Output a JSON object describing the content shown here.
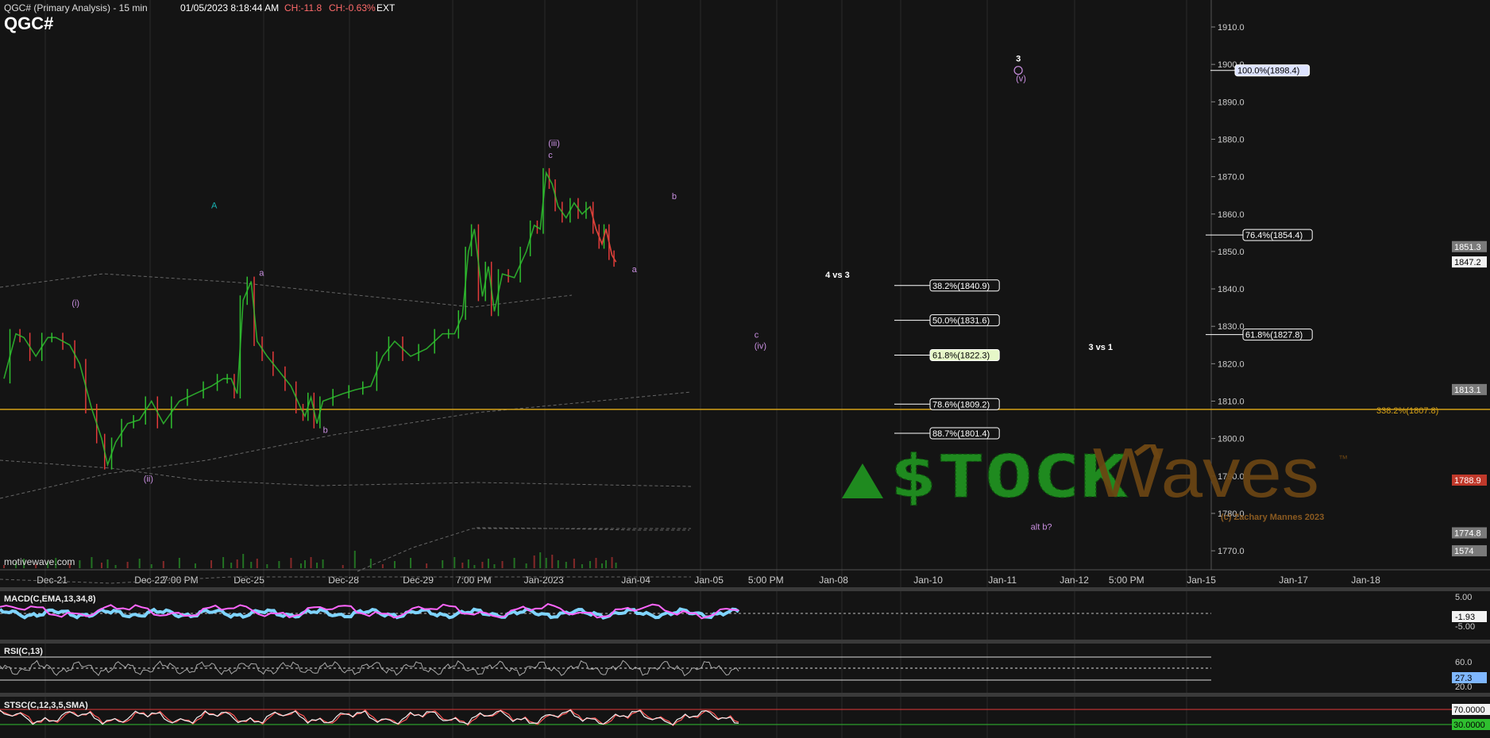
{
  "header": {
    "title": "QGC# (Primary Analysis) - 15 min",
    "datetime": "01/05/2023 8:18:44 AM",
    "change": "CH:-11.8",
    "change_pct": "CH:-0.63%",
    "session": "EXT",
    "symbol": "QGC#"
  },
  "watermark": {
    "site": "motivewave.com",
    "logo_left": "$TOCK",
    "logo_right": "Waves",
    "trademark": "™",
    "copyright": "(c) Zachary Mannes 2023"
  },
  "colors": {
    "background": "#141414",
    "up_candle": "#2fbf2f",
    "down_candle": "#e23a3a",
    "fib_box": "#ffffff",
    "fib_highlight": "#e6f7c8",
    "target_highlight": "#dde3ff",
    "wave_label": "#c98fe0",
    "support_line": "#d4a017",
    "logo_green": "#1f8a1f",
    "logo_brown": "#6b4513"
  },
  "chart_data": {
    "type": "line",
    "title": "QGC# (Primary Analysis) - 15 min",
    "price_axis_ticks": [
      1910.0,
      1900.0,
      1890.0,
      1880.0,
      1870.0,
      1860.0,
      1850.0,
      1840.0,
      1830.0,
      1820.0,
      1810.0,
      1800.0,
      1790.0,
      1780.0,
      1770.0
    ],
    "price_axis_tick_labels": [
      "1910.0",
      "1900.0",
      "1890.0",
      "1880.0",
      "1870.0",
      "1860.0",
      "1850.0",
      "1840.0",
      "1830.0",
      "1820.0",
      "1810.0",
      "1800.0",
      "1790.0",
      "1780.0",
      "1770.0"
    ],
    "ylim": [
      1766,
      1914
    ],
    "time_axis_labels": [
      "Dec-21",
      "Dec-22",
      "7:00 PM",
      "Dec-25",
      "Dec-28",
      "Dec-29",
      "7:00 PM",
      "Jan-2023",
      "Jan-04",
      "Jan-05",
      "5:00 PM",
      "Jan-08",
      "Jan-10",
      "Jan-11",
      "Jan-12",
      "5:00 PM",
      "Jan-15",
      "Jan-17",
      "Jan-18"
    ],
    "price_path": [
      [
        0,
        1816
      ],
      [
        0.03,
        1828
      ],
      [
        0.05,
        1827
      ],
      [
        0.08,
        1822
      ],
      [
        0.11,
        1827
      ],
      [
        0.13,
        1827
      ],
      [
        0.165,
        1825
      ],
      [
        0.19,
        1820
      ],
      [
        0.22,
        1808
      ],
      [
        0.245,
        1800
      ],
      [
        0.26,
        1793
      ],
      [
        0.28,
        1799
      ],
      [
        0.31,
        1804
      ],
      [
        0.34,
        1805
      ],
      [
        0.37,
        1810
      ],
      [
        0.4,
        1804
      ],
      [
        0.44,
        1810
      ],
      [
        0.48,
        1812
      ],
      [
        0.52,
        1814
      ],
      [
        0.55,
        1816
      ],
      [
        0.57,
        1816
      ],
      [
        0.585,
        1812
      ],
      [
        0.6,
        1837
      ],
      [
        0.62,
        1842
      ],
      [
        0.635,
        1826
      ],
      [
        0.66,
        1822
      ],
      [
        0.69,
        1818
      ],
      [
        0.72,
        1814
      ],
      [
        0.745,
        1808
      ],
      [
        0.755,
        1806
      ],
      [
        0.77,
        1811
      ],
      [
        0.785,
        1804
      ],
      [
        0.8,
        1810
      ],
      [
        0.85,
        1812
      ],
      [
        0.88,
        1813
      ],
      [
        0.92,
        1814
      ],
      [
        0.95,
        1822
      ],
      [
        0.98,
        1826
      ],
      [
        1.02,
        1822
      ],
      [
        1.06,
        1824
      ],
      [
        1.1,
        1828
      ],
      [
        1.13,
        1828
      ],
      [
        1.15,
        1833
      ],
      [
        1.165,
        1850
      ],
      [
        1.18,
        1856
      ],
      [
        1.2,
        1838
      ],
      [
        1.215,
        1846
      ],
      [
        1.23,
        1834
      ],
      [
        1.25,
        1844
      ],
      [
        1.28,
        1843
      ],
      [
        1.31,
        1850
      ],
      [
        1.33,
        1857
      ],
      [
        1.345,
        1856
      ],
      [
        1.36,
        1871
      ],
      [
        1.375,
        1868
      ],
      [
        1.39,
        1862
      ],
      [
        1.41,
        1859
      ],
      [
        1.43,
        1863
      ],
      [
        1.45,
        1860
      ],
      [
        1.47,
        1862
      ],
      [
        1.485,
        1856
      ],
      [
        1.5,
        1852
      ],
      [
        1.51,
        1856
      ],
      [
        1.525,
        1849
      ],
      [
        1.535,
        1847.2
      ]
    ],
    "last_price": "1847.2",
    "price_axis_markers": [
      {
        "value": 1851.3,
        "label": "1851.3",
        "style": "grey"
      },
      {
        "value": 1847.2,
        "label": "1847.2",
        "style": "white"
      },
      {
        "value": 1813.1,
        "label": "1813.1",
        "style": "grey"
      },
      {
        "value": 1788.9,
        "label": "1788.9",
        "style": "red"
      },
      {
        "value": 1774.8,
        "label": "1774.8",
        "style": "grey"
      },
      {
        "value": 1770.0,
        "label": "1574",
        "style": "grey"
      }
    ],
    "fib_levels": [
      {
        "label": "100.0%(1898.4)",
        "value": 1898.4,
        "group": "right",
        "highlight": "blue"
      },
      {
        "label": "76.4%(1854.4)",
        "value": 1854.4,
        "group": "right"
      },
      {
        "label": "61.8%(1827.8)",
        "value": 1827.8,
        "group": "right"
      },
      {
        "label": "38.2%(1840.9)",
        "value": 1840.9,
        "group": "mid"
      },
      {
        "label": "50.0%(1831.6)",
        "value": 1831.6,
        "group": "mid"
      },
      {
        "label": "61.8%(1822.3)",
        "value": 1822.3,
        "group": "mid",
        "highlight": "green"
      },
      {
        "label": "78.6%(1809.2)",
        "value": 1809.2,
        "group": "mid"
      },
      {
        "label": "88.7%(1801.4)",
        "value": 1801.4,
        "group": "mid"
      }
    ],
    "support_line": {
      "label": "338.2%(1807.8)",
      "value": 1807.8
    },
    "zone_labels": [
      {
        "text": "4 vs 3",
        "t": 2.06,
        "value": 1843.0
      },
      {
        "text": "3 vs 1",
        "t": 2.72,
        "value": 1823.7
      }
    ],
    "wave_labels": [
      {
        "text": "(i)",
        "t": 0.17,
        "value": 1835.5
      },
      {
        "text": "A",
        "t": 0.52,
        "value": 1861.5,
        "teal": true
      },
      {
        "text": "(ii)",
        "t": 0.35,
        "value": 1788.5
      },
      {
        "text": "a",
        "t": 0.64,
        "value": 1843.5
      },
      {
        "text": "b",
        "t": 0.8,
        "value": 1801.5
      },
      {
        "text": "(iii)",
        "t": 1.365,
        "value": 1878.2
      },
      {
        "text": "c",
        "t": 1.365,
        "value": 1875.0
      },
      {
        "text": "b",
        "t": 1.675,
        "value": 1864.0
      },
      {
        "text": "a",
        "t": 1.575,
        "value": 1844.5
      },
      {
        "text": "c",
        "t": 1.882,
        "value": 1827.0
      },
      {
        "text": "(iv)",
        "t": 1.882,
        "value": 1824.0
      },
      {
        "text": "3",
        "t": 2.538,
        "value": 1900.8,
        "white": true
      },
      {
        "text": "(v)",
        "t": 2.538,
        "value": 1895.5
      },
      {
        "text": "alt b?",
        "t": 2.575,
        "value": 1775.6
      }
    ]
  },
  "indicators": {
    "macd": {
      "label": "MACD(C,EMA,13,34,8)",
      "ticks": [
        "5.00",
        "-5.00"
      ],
      "current": "-1.93"
    },
    "rsi": {
      "label": "RSI(C,13)",
      "ticks": [
        "60.0",
        "20.0"
      ],
      "current": "27.3"
    },
    "stoch": {
      "label": "STSC(C,12,3,5,SMA)",
      "ticks": [
        "70.0000",
        "30.0000"
      ]
    }
  }
}
